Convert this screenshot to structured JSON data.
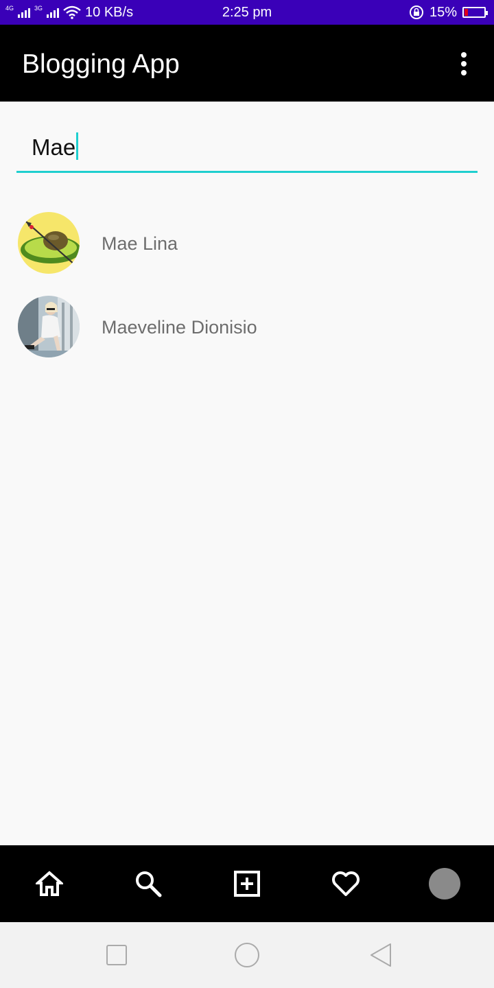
{
  "status_bar": {
    "network_1": "4G",
    "network_2": "3G",
    "speed": "10 KB/s",
    "time": "2:25 pm",
    "battery": "15%"
  },
  "app_bar": {
    "title": "Blogging App",
    "menu_icon": "more-vert-icon"
  },
  "search": {
    "value": "Mae"
  },
  "results": [
    {
      "name": "Mae Lina",
      "avatar": "avocado-illustration"
    },
    {
      "name": "Maeveline Dionisio",
      "avatar": "person-photo"
    }
  ],
  "bottom_nav": [
    {
      "icon": "home-icon"
    },
    {
      "icon": "search-icon"
    },
    {
      "icon": "add-box-icon"
    },
    {
      "icon": "heart-icon"
    },
    {
      "icon": "profile-avatar"
    }
  ],
  "system_nav": [
    "recents-icon",
    "home-circle-icon",
    "back-icon"
  ],
  "colors": {
    "status_bar": "#3a00b8",
    "app_bar": "#000000",
    "accent": "#1fcfcf",
    "background": "#f9f9f9"
  }
}
